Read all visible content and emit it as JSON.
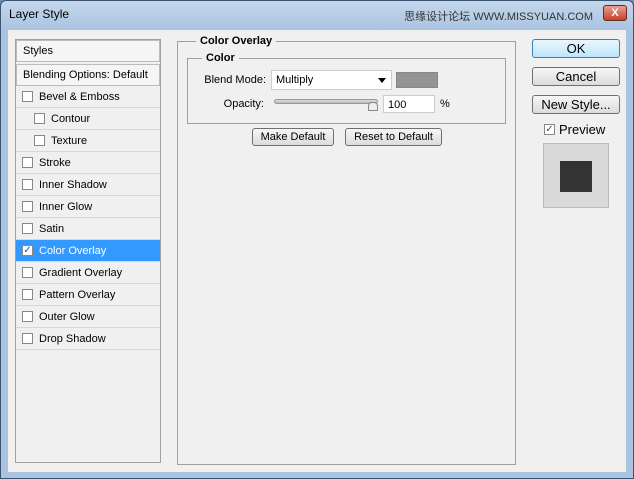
{
  "window": {
    "title": "Layer Style",
    "watermark": "思缘设计论坛 WWW.MISSYUAN.COM",
    "close": "X"
  },
  "sidebar": {
    "header": "Styles",
    "blending": "Blending Options: Default",
    "items": [
      {
        "label": "Bevel & Emboss",
        "checked": false,
        "sub": false
      },
      {
        "label": "Contour",
        "checked": false,
        "sub": true
      },
      {
        "label": "Texture",
        "checked": false,
        "sub": true
      },
      {
        "label": "Stroke",
        "checked": false,
        "sub": false
      },
      {
        "label": "Inner Shadow",
        "checked": false,
        "sub": false
      },
      {
        "label": "Inner Glow",
        "checked": false,
        "sub": false
      },
      {
        "label": "Satin",
        "checked": false,
        "sub": false
      },
      {
        "label": "Color Overlay",
        "checked": true,
        "sub": false,
        "selected": true
      },
      {
        "label": "Gradient Overlay",
        "checked": false,
        "sub": false
      },
      {
        "label": "Pattern Overlay",
        "checked": false,
        "sub": false
      },
      {
        "label": "Outer Glow",
        "checked": false,
        "sub": false
      },
      {
        "label": "Drop Shadow",
        "checked": false,
        "sub": false
      }
    ]
  },
  "panel": {
    "title": "Color Overlay",
    "group": "Color",
    "blend_label": "Blend Mode:",
    "blend_value": "Multiply",
    "overlay_color": "#949494",
    "opacity_label": "Opacity:",
    "opacity_value": "100",
    "opacity_unit": "%",
    "opacity_percent": 100,
    "make_default": "Make Default",
    "reset_default": "Reset to Default"
  },
  "actions": {
    "ok": "OK",
    "cancel": "Cancel",
    "new_style": "New Style...",
    "preview": "Preview",
    "preview_checked": true
  }
}
